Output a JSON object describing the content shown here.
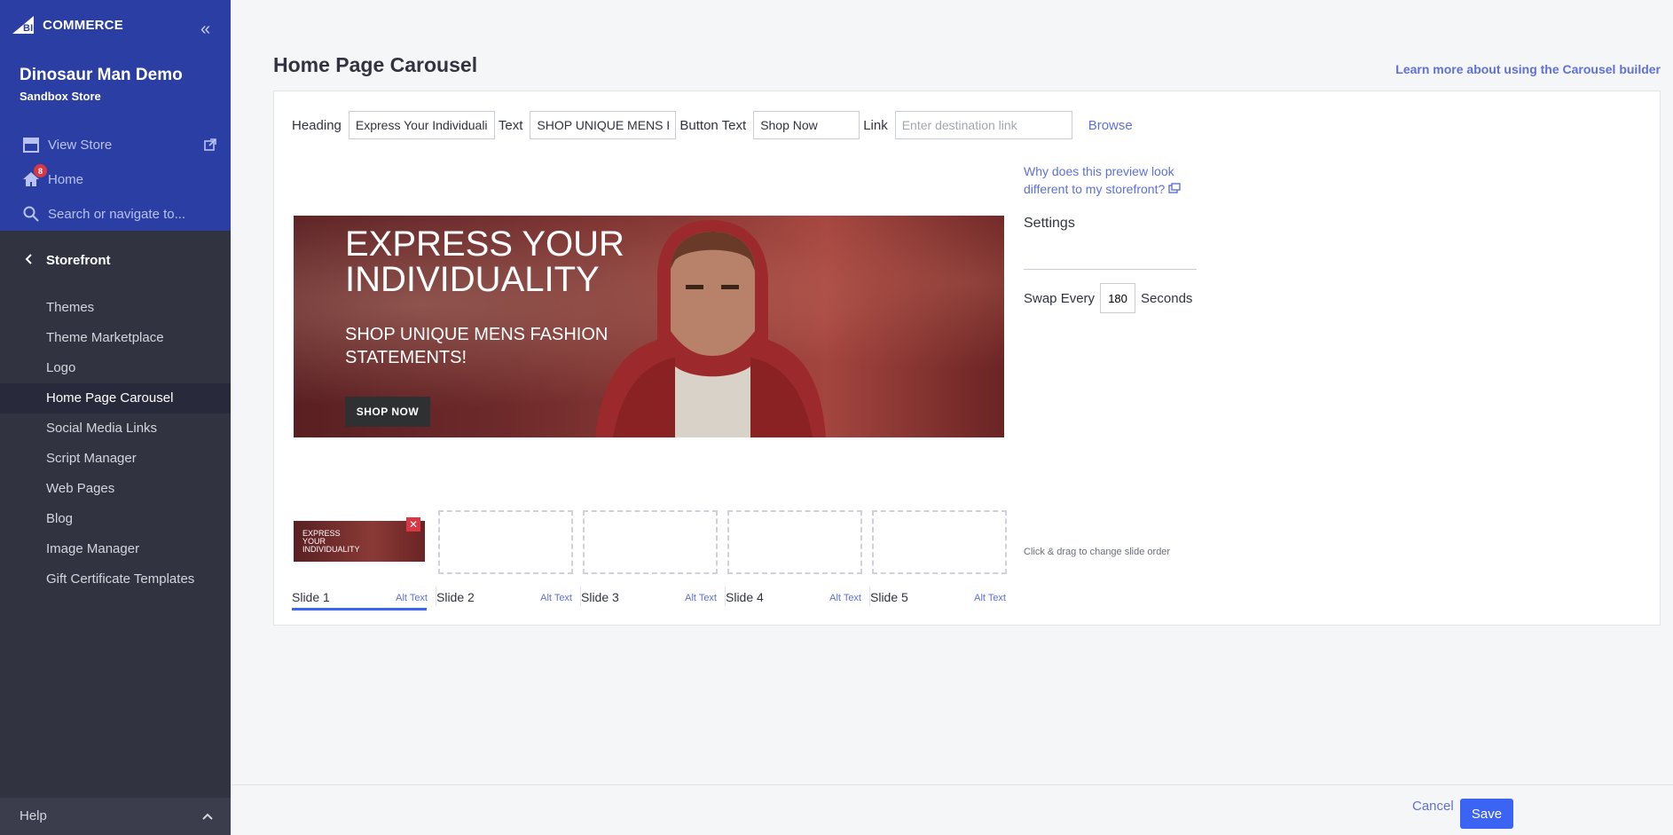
{
  "brand": {
    "logo_text": "COMMERCE",
    "logo_prefix": "BIG"
  },
  "store": {
    "name": "Dinosaur Man Demo",
    "subtitle": "Sandbox Store"
  },
  "top_links": {
    "view_store": "View Store",
    "home": "Home",
    "home_badge": "8",
    "search": "Search or navigate to..."
  },
  "section": {
    "label": "Storefront"
  },
  "nav": [
    {
      "label": "Themes"
    },
    {
      "label": "Theme Marketplace"
    },
    {
      "label": "Logo"
    },
    {
      "label": "Home Page Carousel",
      "active": true
    },
    {
      "label": "Social Media Links"
    },
    {
      "label": "Script Manager"
    },
    {
      "label": "Web Pages"
    },
    {
      "label": "Blog"
    },
    {
      "label": "Image Manager"
    },
    {
      "label": "Gift Certificate Templates"
    }
  ],
  "help": {
    "label": "Help"
  },
  "page": {
    "title": "Home Page Carousel",
    "learn_more": "Learn more about using the Carousel builder"
  },
  "form": {
    "heading_label": "Heading",
    "heading_value": "Express Your Individuali",
    "text_label": "Text",
    "text_value": "SHOP UNIQUE MENS FA",
    "button_text_label": "Button Text",
    "button_text_value": "Shop Now",
    "link_label": "Link",
    "link_placeholder": "Enter destination link",
    "browse": "Browse"
  },
  "preview": {
    "why_link": "Why does this preview look different to my storefront?",
    "heading": "EXPRESS YOUR INDIVIDUALITY",
    "text": "SHOP UNIQUE MENS FASHION STATEMENTS!",
    "button": "SHOP NOW"
  },
  "settings": {
    "title": "Settings",
    "swap_label": "Swap Every",
    "swap_value": "180",
    "swap_unit": "Seconds"
  },
  "slides": [
    {
      "label": "Slide 1",
      "alt": "Alt Text",
      "thumb_text": "EXPRESS YOUR INDIVIDUALITY",
      "active": true
    },
    {
      "label": "Slide 2",
      "alt": "Alt Text"
    },
    {
      "label": "Slide 3",
      "alt": "Alt Text"
    },
    {
      "label": "Slide 4",
      "alt": "Alt Text"
    },
    {
      "label": "Slide 5",
      "alt": "Alt Text"
    }
  ],
  "drag_note": "Click & drag to change slide order",
  "footer": {
    "cancel": "Cancel",
    "save": "Save"
  },
  "colors": {
    "sidebar_top": "#2b3ea3",
    "sidebar": "#313440",
    "accent": "#3c64f4",
    "link": "#5e71d6",
    "danger": "#db3643"
  }
}
